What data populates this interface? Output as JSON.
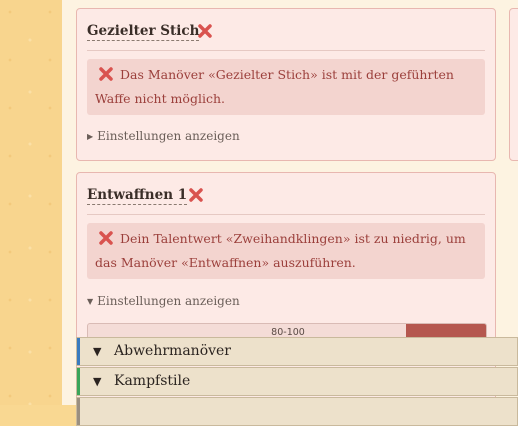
{
  "cards": [
    {
      "title": "Gezielter Stich",
      "error": "Das Manöver «Gezielter Stich» ist mit der geführten Waffe nicht möglich.",
      "settings_label": "Einstellungen anzeigen",
      "settings_icon": "triangle-right"
    },
    {
      "title": "Entwaffnen 1",
      "error": "Dein Talentwert «Zweihandklingen» ist zu niedrig, um das Manöver «Entwaffnen» auszuführen.",
      "settings_label": "Einstellungen anzeigen",
      "settings_icon": "triangle-down",
      "range_label": "80-100"
    }
  ],
  "sections": [
    {
      "label": "Abwehrmanöver",
      "accent": "#3a7bbf",
      "icon": "triangle-down"
    },
    {
      "label": "Kampfstile",
      "accent": "#3aa55a",
      "icon": "triangle-down"
    }
  ],
  "colors": {
    "error_text": "#9b3f3b",
    "error_bg": "#f3d4cf",
    "remove_icon": "#d9534f",
    "range_fill": "#b5574f"
  }
}
